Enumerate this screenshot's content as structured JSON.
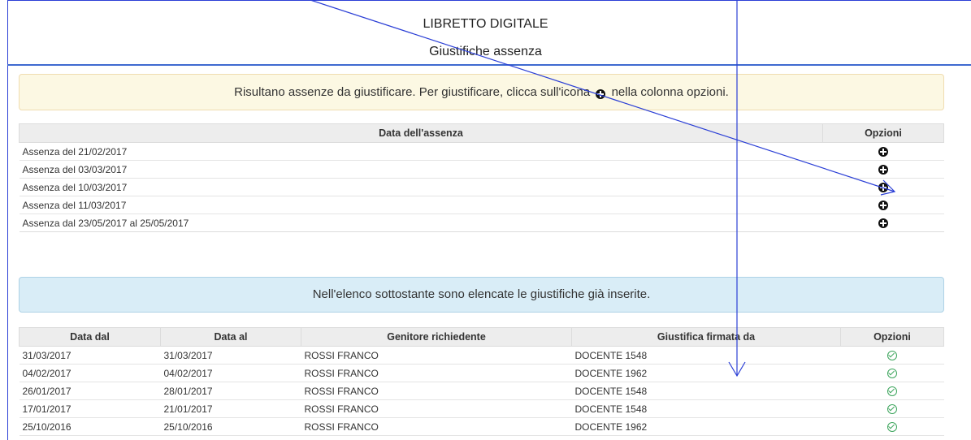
{
  "header": {
    "title": "LIBRETTO DIGITALE",
    "subtitle": "Giustifiche assenza"
  },
  "alert_warning": {
    "text_before": "Risultano assenze da giustificare. Per giustificare, clicca sull'icona",
    "icon": "plus-circle-icon",
    "text_after": "nella colonna opzioni."
  },
  "absences_table": {
    "headers": [
      "Data dell'assenza",
      "Opzioni"
    ],
    "rows": [
      {
        "label": "Assenza del 21/02/2017",
        "action_icon": "plus-circle-icon"
      },
      {
        "label": "Assenza del 03/03/2017",
        "action_icon": "plus-circle-icon"
      },
      {
        "label": "Assenza del 10/03/2017",
        "action_icon": "plus-circle-icon"
      },
      {
        "label": "Assenza del 11/03/2017",
        "action_icon": "plus-circle-icon"
      },
      {
        "label": "Assenza dal 23/05/2017 al 25/05/2017",
        "action_icon": "plus-circle-icon"
      }
    ]
  },
  "alert_info": {
    "text": "Nell'elenco sottostante sono elencate le giustifiche già inserite."
  },
  "justifications_table": {
    "headers": [
      "Data dal",
      "Data al",
      "Genitore richiedente",
      "Giustifica firmata da",
      "Opzioni"
    ],
    "rows": [
      {
        "dal": "31/03/2017",
        "al": "31/03/2017",
        "genitore": "ROSSI FRANCO",
        "firmata": "DOCENTE 1548",
        "status_icon": "check-circle-icon"
      },
      {
        "dal": "04/02/2017",
        "al": "04/02/2017",
        "genitore": "ROSSI FRANCO",
        "firmata": "DOCENTE 1962",
        "status_icon": "check-circle-icon"
      },
      {
        "dal": "26/01/2017",
        "al": "28/01/2017",
        "genitore": "ROSSI FRANCO",
        "firmata": "DOCENTE 1548",
        "status_icon": "check-circle-icon"
      },
      {
        "dal": "17/01/2017",
        "al": "21/01/2017",
        "genitore": "ROSSI FRANCO",
        "firmata": "DOCENTE 1548",
        "status_icon": "check-circle-icon"
      },
      {
        "dal": "25/10/2016",
        "al": "25/10/2016",
        "genitore": "ROSSI FRANCO",
        "firmata": "DOCENTE 1962",
        "status_icon": "check-circle-icon"
      }
    ]
  },
  "colors": {
    "annotation_line": "#2b3fd6",
    "warning_bg": "#fcf8e3",
    "info_bg": "#d9edf7",
    "check_green": "#3ca55c"
  }
}
